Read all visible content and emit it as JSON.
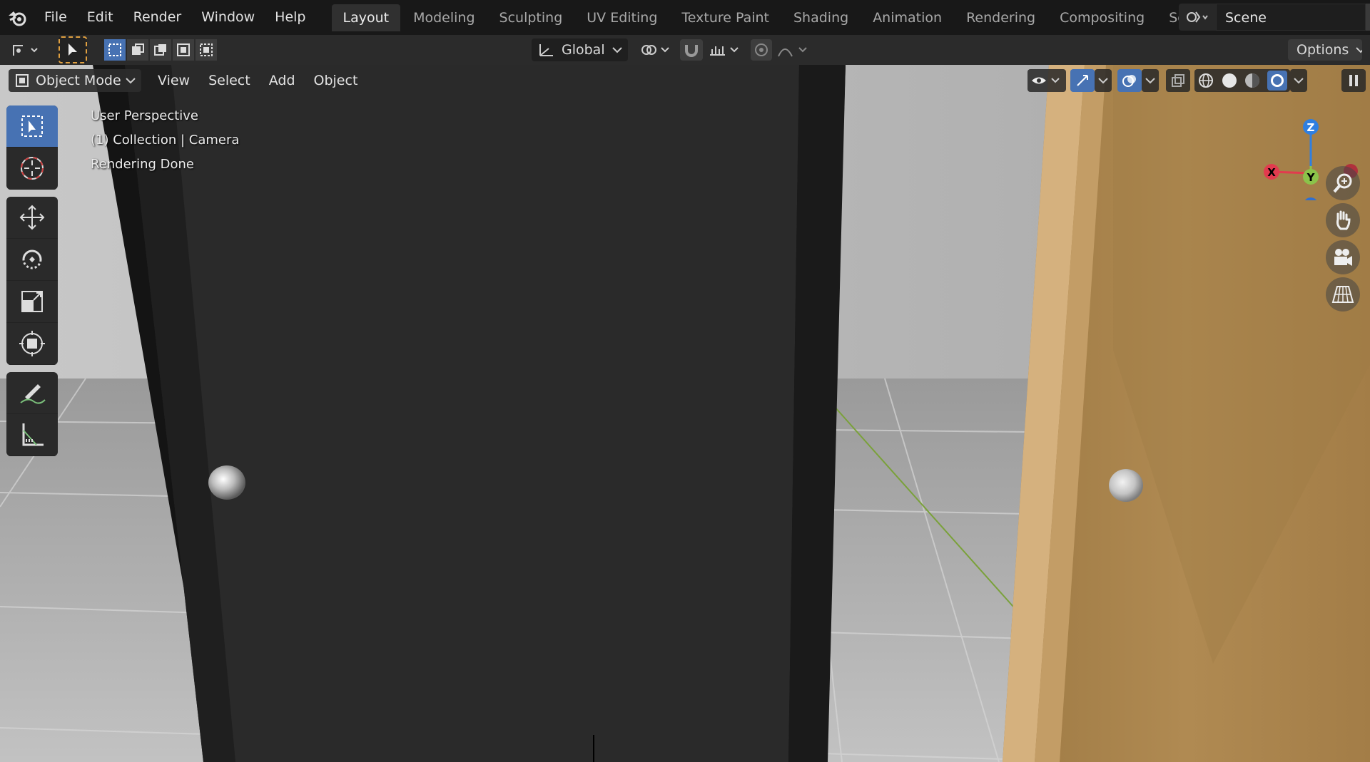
{
  "app": {
    "menu": [
      "File",
      "Edit",
      "Render",
      "Window",
      "Help"
    ],
    "workspaces": [
      "Layout",
      "Modeling",
      "Sculpting",
      "UV Editing",
      "Texture Paint",
      "Shading",
      "Animation",
      "Rendering",
      "Compositing",
      "Scripting"
    ],
    "active_workspace": "Layout",
    "add_workspace": "+",
    "scene_name": "Scene"
  },
  "tool_header": {
    "transform_orientation": "Global",
    "options_label": "Options"
  },
  "viewport": {
    "mode": "Object Mode",
    "menu": [
      "View",
      "Select",
      "Add",
      "Object"
    ],
    "overlay_lines": [
      "User Perspective",
      "(1) Collection | Camera",
      "Rendering Done"
    ],
    "gizmo": {
      "x": "X",
      "y": "Y",
      "z": "Z"
    }
  },
  "colors": {
    "accent": "#4772b3",
    "axis_x": "#e23b4e",
    "axis_y": "#8bc34a",
    "axis_z": "#2f7fe0",
    "door_dark": "#2a2a2a",
    "door_wood": "#b58c55"
  },
  "icons": {
    "toolbar": [
      "select-box-icon",
      "cursor-icon",
      "move-icon",
      "rotate-icon",
      "scale-icon",
      "transform-icon",
      "annotate-icon",
      "measure-icon"
    ],
    "navigation": [
      "zoom-icon",
      "pan-hand-icon",
      "camera-view-icon",
      "ortho-grid-icon"
    ]
  }
}
